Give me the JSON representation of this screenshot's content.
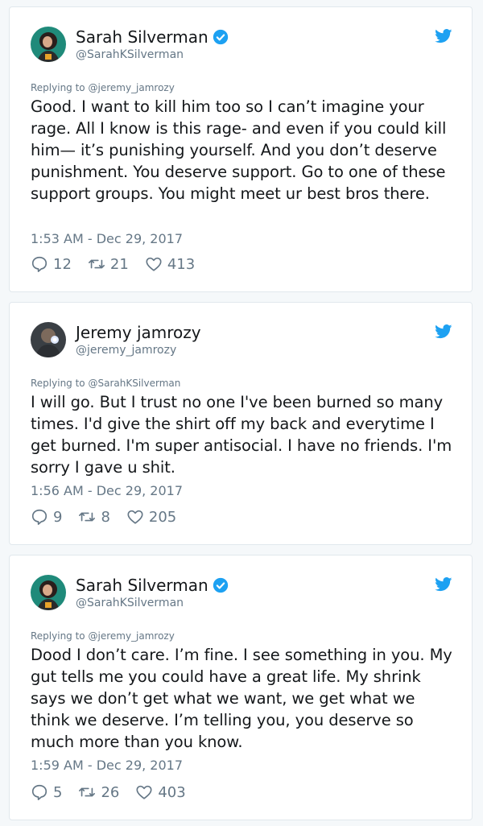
{
  "colors": {
    "background": "#f5f8fa",
    "card": "#ffffff",
    "text": "#14171a",
    "muted": "#657786",
    "twitter_blue": "#1da1f2"
  },
  "tweets": [
    {
      "name": "Sarah Silverman",
      "verified": true,
      "handle": "@SarahKSilverman",
      "reply_prefix": "Replying to",
      "reply_to": "@jeremy_jamrozy",
      "text": "Good. I want to kill him too so I can’t imagine your rage. All I know is this rage- and even if you could kill him— it’s punishing yourself. And you don’t deserve punishment. You deserve support. Go to one of these support groups. You might meet ur best bros there.",
      "time": "1:53 AM - Dec 29, 2017",
      "replies": "12",
      "retweets": "21",
      "likes": "413",
      "icon": "twitter-bird-icon"
    },
    {
      "name": "Jeremy jamrozy",
      "verified": false,
      "handle": "@jeremy_jamrozy",
      "reply_prefix": "Replying to",
      "reply_to": "@SarahKSilverman",
      "text": "I will go. But I trust no one I've been burned so many times. I'd give the shirt off my back and everytime I get burned. I'm super antisocial. I have no friends. I'm sorry I gave u shit.",
      "time": "1:56 AM - Dec 29, 2017",
      "replies": "9",
      "retweets": "8",
      "likes": "205",
      "icon": "twitter-bird-icon"
    },
    {
      "name": "Sarah Silverman",
      "verified": true,
      "handle": "@SarahKSilverman",
      "reply_prefix": "Replying to",
      "reply_to": "@jeremy_jamrozy",
      "text": "Dood I don’t care. I’m fine. I see something in you. My gut tells me you could have a great life. My shrink says we don’t get what we want, we get what we think we deserve. I’m telling you, you deserve so much more than you know.",
      "time": "1:59 AM - Dec 29, 2017",
      "replies": "5",
      "retweets": "26",
      "likes": "403",
      "icon": "twitter-bird-icon"
    }
  ]
}
